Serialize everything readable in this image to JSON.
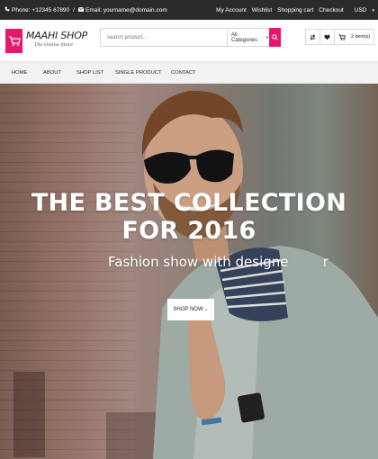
{
  "topbar": {
    "phone_label": "Phone: +12345 67890",
    "separator": "/",
    "email_label": "Email: yourname@domain.com",
    "links": [
      "My Account",
      "Wishlist",
      "Shopping cart",
      "Checkout"
    ],
    "currency": "USD"
  },
  "header": {
    "logo_title": "MAAHI SHOP",
    "logo_subtitle": "The Online Store",
    "search_placeholder": "search product...",
    "category_selected": "All Categories",
    "cart_count": "2 item(s)"
  },
  "nav": {
    "items": [
      "HOME",
      "ABOUT",
      "SHOP LIST",
      "SINGLE PRODUCT",
      "CONTACT"
    ]
  },
  "hero": {
    "title": "THE BEST COLLECTION FOR 2016",
    "subtitle": "Fashion show with designe        r",
    "button_label": "SHOP NOW"
  },
  "colors": {
    "accent": "#e6186d",
    "topbar_bg": "#2b2b2b",
    "nav_bg": "#f2f2f2"
  },
  "icons": [
    "phone-icon",
    "email-icon",
    "cart-logo-icon",
    "search-icon",
    "compare-icon",
    "heart-icon",
    "cart-icon",
    "arrow-right-icon"
  ]
}
